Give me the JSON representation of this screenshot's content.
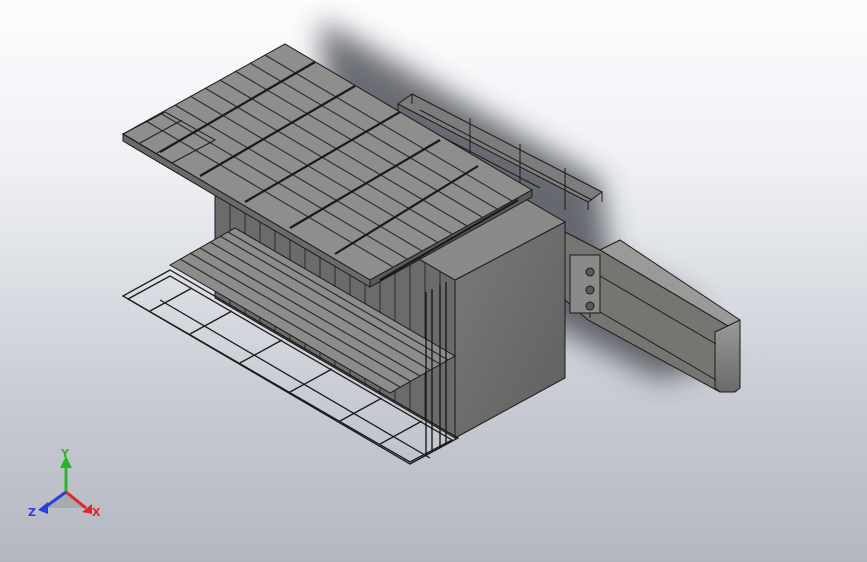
{
  "viewport": {
    "background_top": "#fdfdfe",
    "background_bottom": "#b4b7c0",
    "model_color": "#6e6e6e",
    "model_edge_color": "#1a1a1a",
    "shadow_color": "#3b3d44"
  },
  "triad": {
    "x_label": "X",
    "y_label": "Y",
    "z_label": "Z",
    "x_color": "#e0262a",
    "y_color": "#2cb52c",
    "z_color": "#2a3fd8"
  }
}
